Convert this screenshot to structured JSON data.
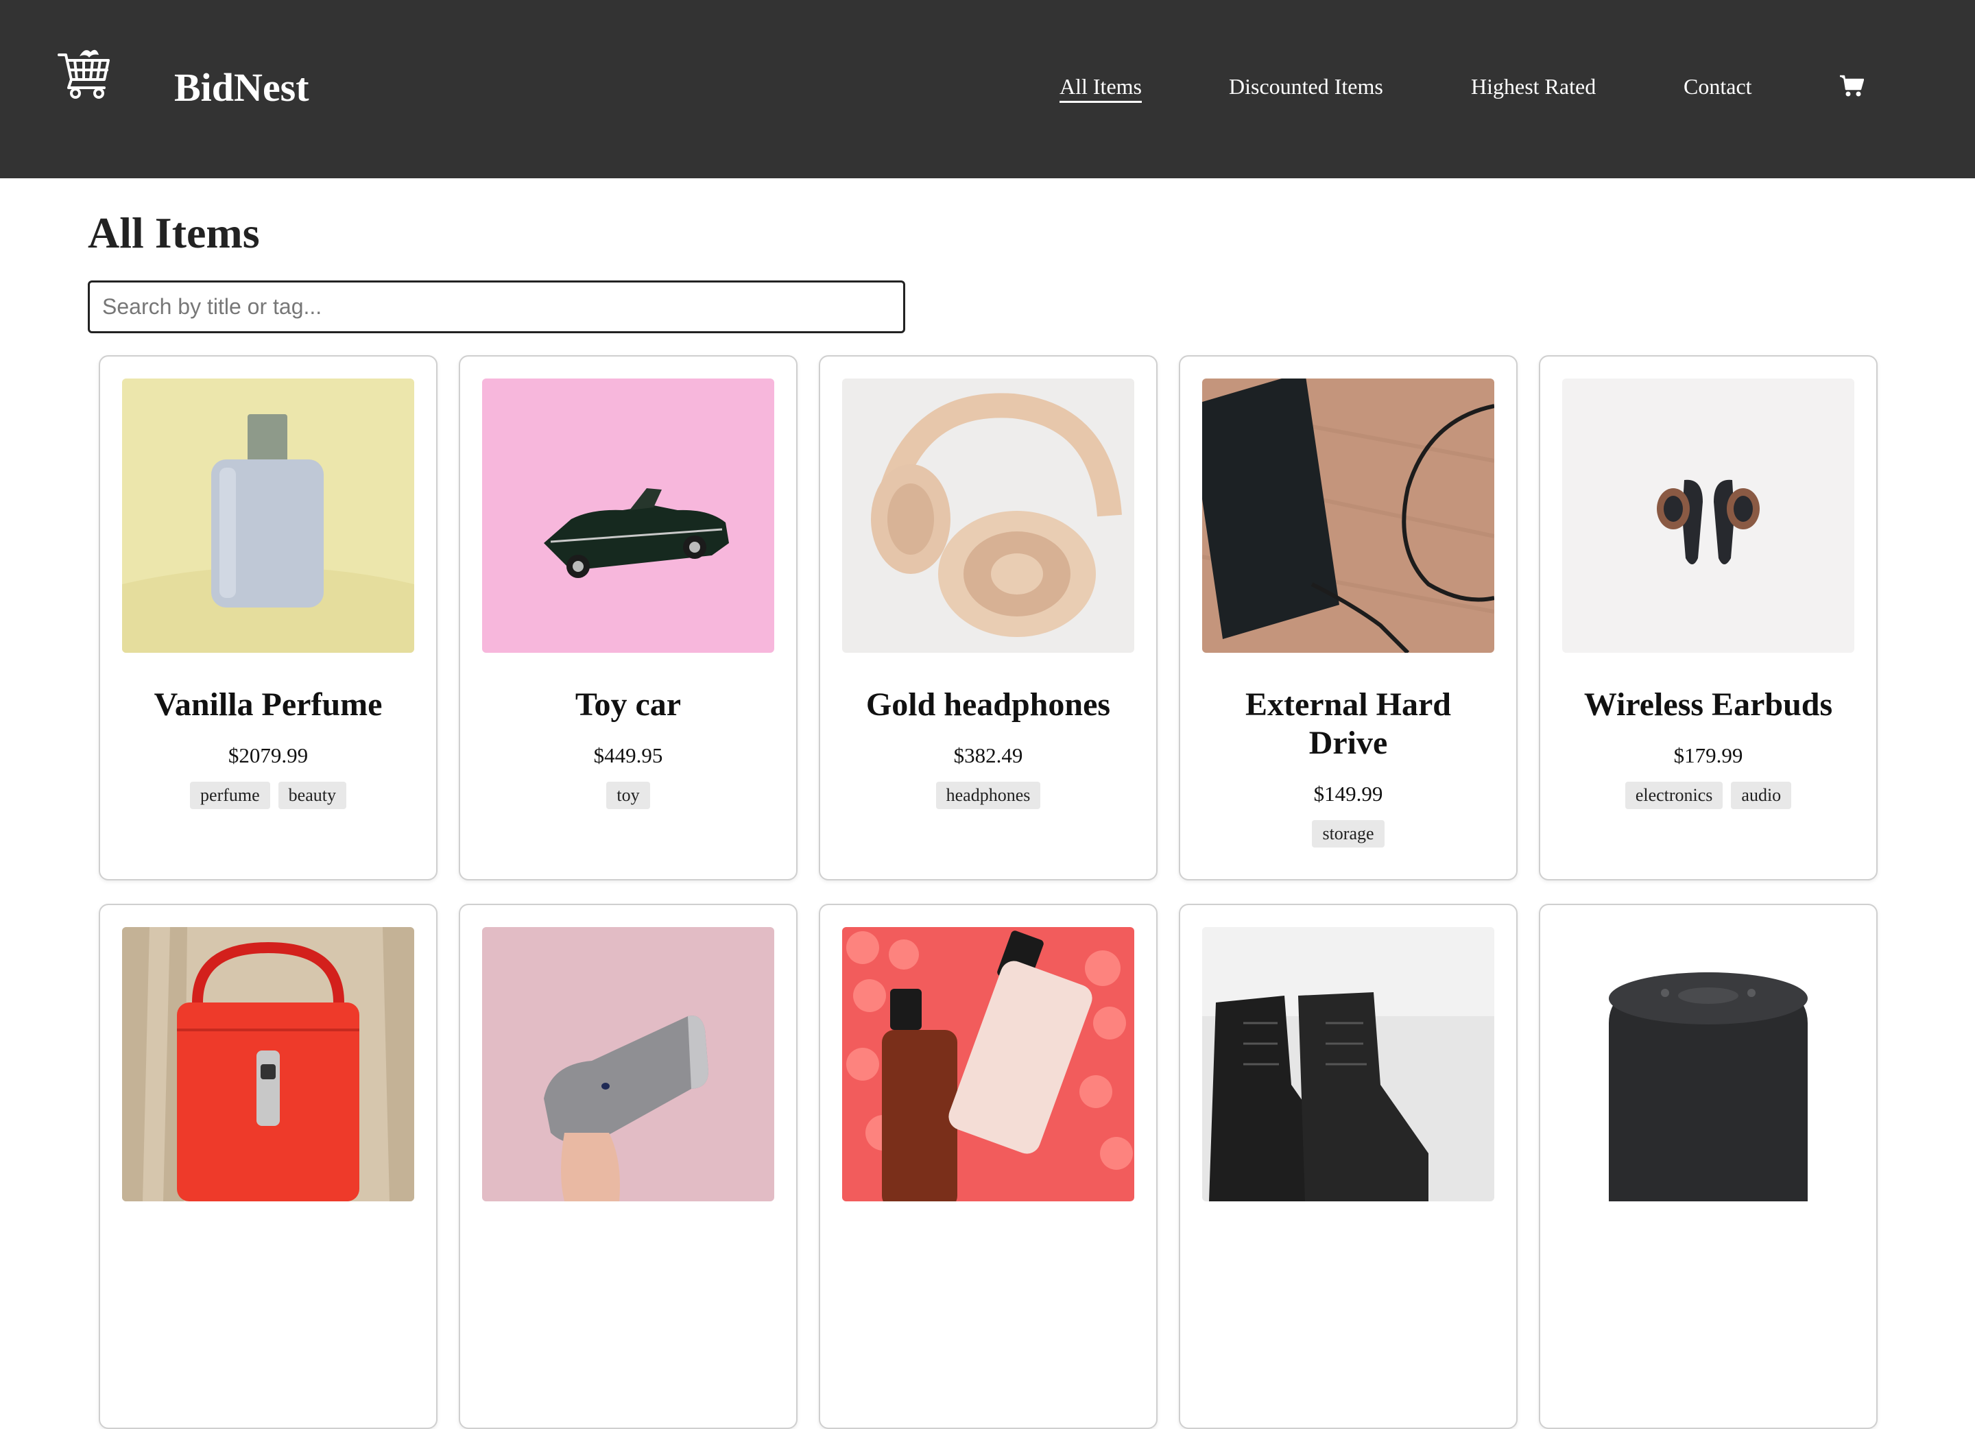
{
  "header": {
    "brand": "BidNest",
    "nav": [
      {
        "label": "All Items",
        "active": true
      },
      {
        "label": "Discounted Items",
        "active": false
      },
      {
        "label": "Highest Rated",
        "active": false
      },
      {
        "label": "Contact",
        "active": false
      }
    ],
    "logo_icon": "shopping-cart-logo-icon",
    "cart_icon": "shopping-cart-icon",
    "background_color": "#333333"
  },
  "main": {
    "title": "All Items",
    "search": {
      "placeholder": "Search by title or tag...",
      "value": ""
    },
    "items": [
      {
        "title": "Vanilla Perfume",
        "price": "$2079.99",
        "tags": [
          "perfume",
          "beauty"
        ],
        "image": "perfume-bottle"
      },
      {
        "title": "Toy car",
        "price": "$449.95",
        "tags": [
          "toy"
        ],
        "image": "toy-car"
      },
      {
        "title": "Gold headphones",
        "price": "$382.49",
        "tags": [
          "headphones"
        ],
        "image": "headphones"
      },
      {
        "title": "External Hard Drive",
        "price": "$149.99",
        "tags": [
          "storage"
        ],
        "image": "hard-drive"
      },
      {
        "title": "Wireless Earbuds",
        "price": "$179.99",
        "tags": [
          "electronics",
          "audio"
        ],
        "image": "earbuds"
      },
      {
        "title": "",
        "price": "",
        "tags": [],
        "image": "red-handbag"
      },
      {
        "title": "",
        "price": "",
        "tags": [],
        "image": "hair-dryer"
      },
      {
        "title": "",
        "price": "",
        "tags": [],
        "image": "serum-bottles"
      },
      {
        "title": "",
        "price": "",
        "tags": [],
        "image": "black-boots"
      },
      {
        "title": "",
        "price": "",
        "tags": [],
        "image": "bluetooth-speaker"
      }
    ]
  }
}
